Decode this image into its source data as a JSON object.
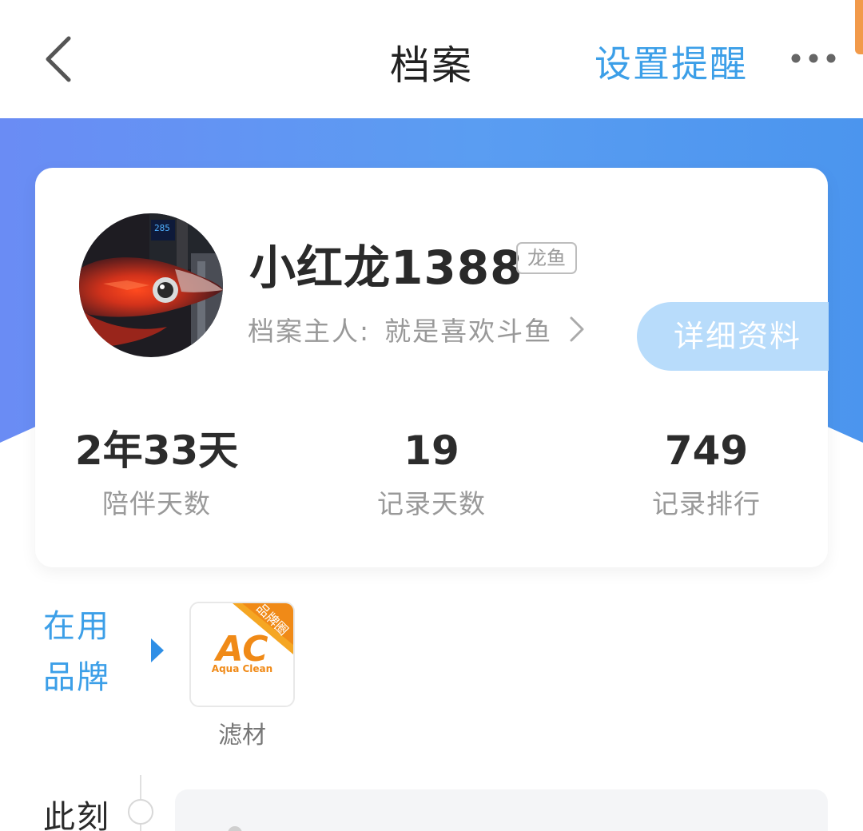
{
  "nav": {
    "title": "档案",
    "action": "设置提醒"
  },
  "profile": {
    "name": "小红龙1388",
    "species_tag": "龙鱼",
    "owner_label": "档案主人:",
    "owner_name": "就是喜欢斗鱼",
    "detail_button": "详细资料"
  },
  "stats": [
    {
      "value": "2年33天",
      "label": "陪伴天数"
    },
    {
      "value": "19",
      "label": "记录天数"
    },
    {
      "value": "749",
      "label": "记录排行"
    }
  ],
  "brands": {
    "title": "在用品牌",
    "items": [
      {
        "logo_text": "AC",
        "logo_subtext": "Aqua Clean",
        "ribbon": "品牌圈",
        "caption": "滤材"
      }
    ]
  },
  "timeline": {
    "label": "此刻"
  },
  "colors": {
    "accent": "#3c9fe8",
    "header_band": "#5a9df2",
    "detail_button": "#b8dcfb",
    "brand_orange": "#f08a17",
    "scroll_indicator": "#f29a4a"
  },
  "icons": [
    "back-chevron-icon",
    "more-dots-icon",
    "chevron-right-icon",
    "triangle-arrow-icon"
  ]
}
